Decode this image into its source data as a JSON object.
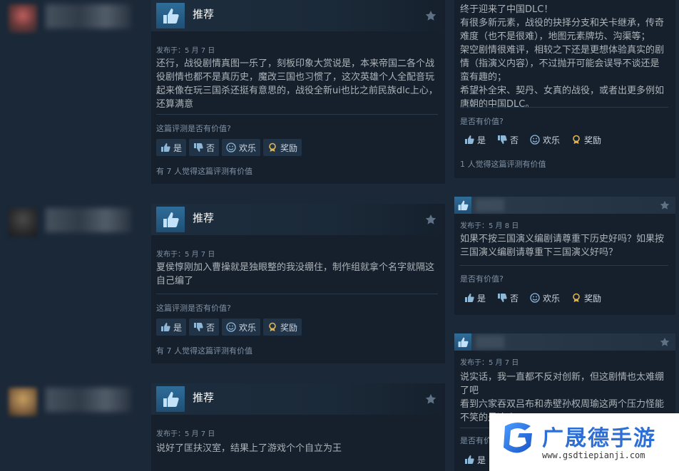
{
  "labels": {
    "recommended": "推荐",
    "helpful_question": "这篇评测是否有价值?",
    "yes": "是",
    "no": "否",
    "funny": "欢乐",
    "award": "奖励"
  },
  "reviews": [
    {
      "posted": "发布于：5 月 7 日",
      "text": "还行，战役剧情真图一乐了，刻板印象大赏说是，本来帝国二各个战役剧情也都不是真历史，魔改三国也习惯了，这次英雄个人全配音玩起来像在玩三国杀还挺有意思的，战役全新ui也比之前民族dlc上心，还算满意",
      "helpful_count": "有 7 人觉得这篇评测有价值"
    },
    {
      "posted": "发布于：5 月 7 日",
      "text": "夏侯惇刚加入曹操就是独眼整的我没绷住，制作组就拿个名字就隔这自己编了",
      "helpful_count": "有 7 人觉得这篇评测有价值"
    },
    {
      "posted": "发布于：5 月 7 日",
      "text": "说好了匡扶汉室，结果上了游戏个个自立为王"
    }
  ],
  "right_reviews": [
    {
      "text": "终于迎来了中国DLC！\n有很多新元素，战役的抉择分支和关卡继承，传奇难度（也不是很难），地图元素牌坊、沟渠等；\n架空剧情很难评，相较之下还是更想体验真实的剧情（指演义内容），不过抛开可能会误导不谈还是蛮有趣的；\n希望补全宋、契丹、女真的战役，或者出更多例如唐朝的中国DLC。",
      "helpful_q": "是否有价值?",
      "helpful_count": "1 人觉得这篇评测有价值"
    },
    {
      "posted": "发布于：5 月 8 日",
      "text": "如果不按三国演义编剧请尊重下历史好吗？如果按三国演义编剧请尊重下三国演义好吗？",
      "helpful_q": "是否有价值?"
    },
    {
      "posted": "发布于：5 月 7 日",
      "text": "说实话，我一直都不反对创新，但这剧情也太难绷了吧\n看到六家吞双吕布和赤壁孙权周瑜这两个压力怪能不笑的是这个",
      "helpful_q": "是否有价值?"
    }
  ],
  "watermark": {
    "title": "广晟德手游",
    "url": "www.gsdtiepianji.com"
  }
}
